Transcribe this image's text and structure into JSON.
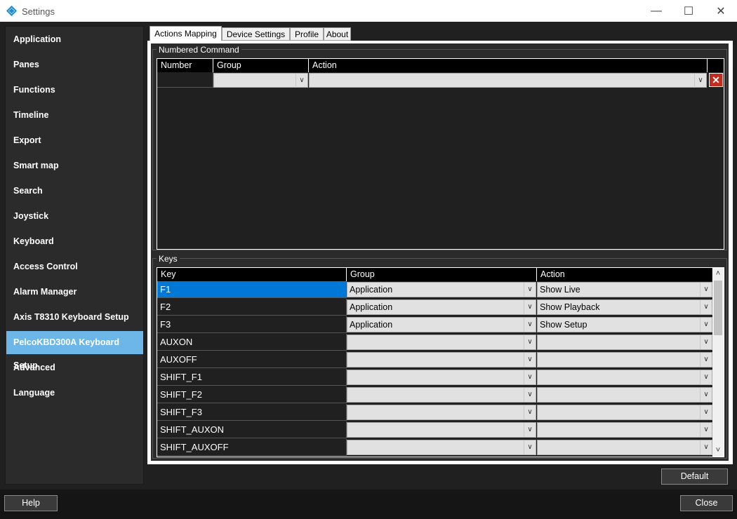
{
  "window": {
    "title": "Settings",
    "minimize_glyph": "—",
    "maximize_glyph": "☐",
    "close_glyph": "✕"
  },
  "sidebar": {
    "items": [
      {
        "label": "Application"
      },
      {
        "label": "Panes"
      },
      {
        "label": "Functions"
      },
      {
        "label": "Timeline"
      },
      {
        "label": "Export"
      },
      {
        "label": "Smart map"
      },
      {
        "label": "Search"
      },
      {
        "label": "Joystick"
      },
      {
        "label": "Keyboard"
      },
      {
        "label": "Access Control"
      },
      {
        "label": "Alarm Manager"
      },
      {
        "label": "Axis T8310 Keyboard Setup"
      },
      {
        "label": "PelcoKBD300A Keyboard Setup",
        "active": true
      },
      {
        "label": "Advanced"
      },
      {
        "label": "Language"
      }
    ]
  },
  "tabs": [
    {
      "label": "Actions Mapping",
      "active": true
    },
    {
      "label": "Device Settings"
    },
    {
      "label": "Profile"
    },
    {
      "label": "About"
    }
  ],
  "numbered_command": {
    "title": "Numbered Command",
    "headers": {
      "number": "Number",
      "group": "Group",
      "action": "Action"
    },
    "row": {
      "number": "",
      "group": "",
      "action": ""
    },
    "delete_glyph": "✕"
  },
  "keys": {
    "title": "Keys",
    "headers": {
      "key": "Key",
      "group": "Group",
      "action": "Action"
    },
    "rows": [
      {
        "key": "F1",
        "group": "Application",
        "action": "Show Live"
      },
      {
        "key": "F2",
        "group": "Application",
        "action": "Show Playback"
      },
      {
        "key": "F3",
        "group": "Application",
        "action": "Show Setup"
      },
      {
        "key": "AUXON",
        "group": "",
        "action": ""
      },
      {
        "key": "AUXOFF",
        "group": "",
        "action": ""
      },
      {
        "key": "SHIFT_F1",
        "group": "",
        "action": ""
      },
      {
        "key": "SHIFT_F2",
        "group": "",
        "action": ""
      },
      {
        "key": "SHIFT_F3",
        "group": "",
        "action": ""
      },
      {
        "key": "SHIFT_AUXON",
        "group": "",
        "action": ""
      },
      {
        "key": "SHIFT_AUXOFF",
        "group": "",
        "action": ""
      }
    ],
    "selected_row": 0
  },
  "buttons": {
    "default_label": "Default",
    "help_label": "Help",
    "close_label": "Close"
  },
  "icons": {
    "dropdown": "chevron-down-icon",
    "scroll_up": "˄",
    "scroll_down": "˅",
    "dropdown_glyph": "∨"
  },
  "colors": {
    "accent_active": "#6cb7e8",
    "selection": "#0078d7",
    "delete_red": "#c42b1c"
  }
}
